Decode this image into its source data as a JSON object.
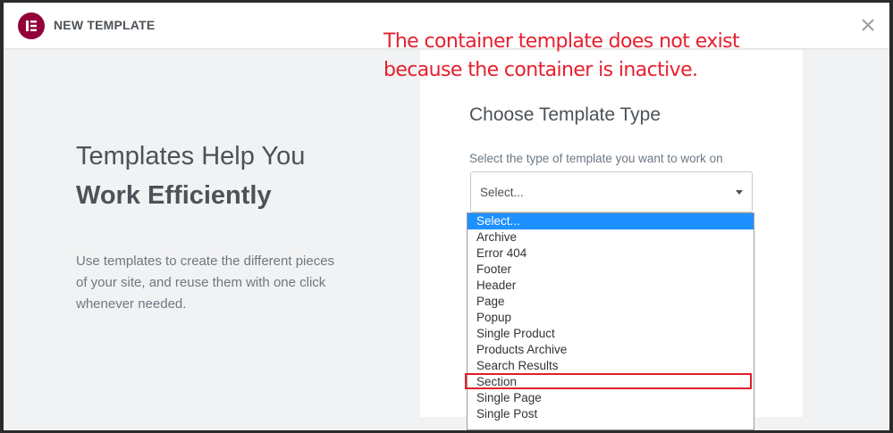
{
  "modal": {
    "title": "NEW TEMPLATE",
    "close_icon": "close-icon",
    "logo_icon": "elementor-logo-icon",
    "brand_color": "#92003b"
  },
  "left": {
    "headline_line1": "Templates Help You",
    "headline_line2": "Work Efficiently",
    "description": "Use templates to create the different pieces of your site, and reuse them with one click whenever needed."
  },
  "card": {
    "title": "Choose Template Type",
    "label": "Select the type of template you want to work on",
    "select_value": "Select..."
  },
  "dropdown": {
    "options": [
      "Select...",
      "Archive",
      "Error 404",
      "Footer",
      "Header",
      "Page",
      "Popup",
      "Single Product",
      "Products Archive",
      "Search Results",
      "Section",
      "Single Page",
      "Single Post"
    ],
    "selected_index": 0,
    "highlighted_option": "Section",
    "selected_color": "#1e90ff"
  },
  "annotation": {
    "line1": "The container template does not exist",
    "line2": "because the container is inactive.",
    "color": "#e5202e"
  }
}
